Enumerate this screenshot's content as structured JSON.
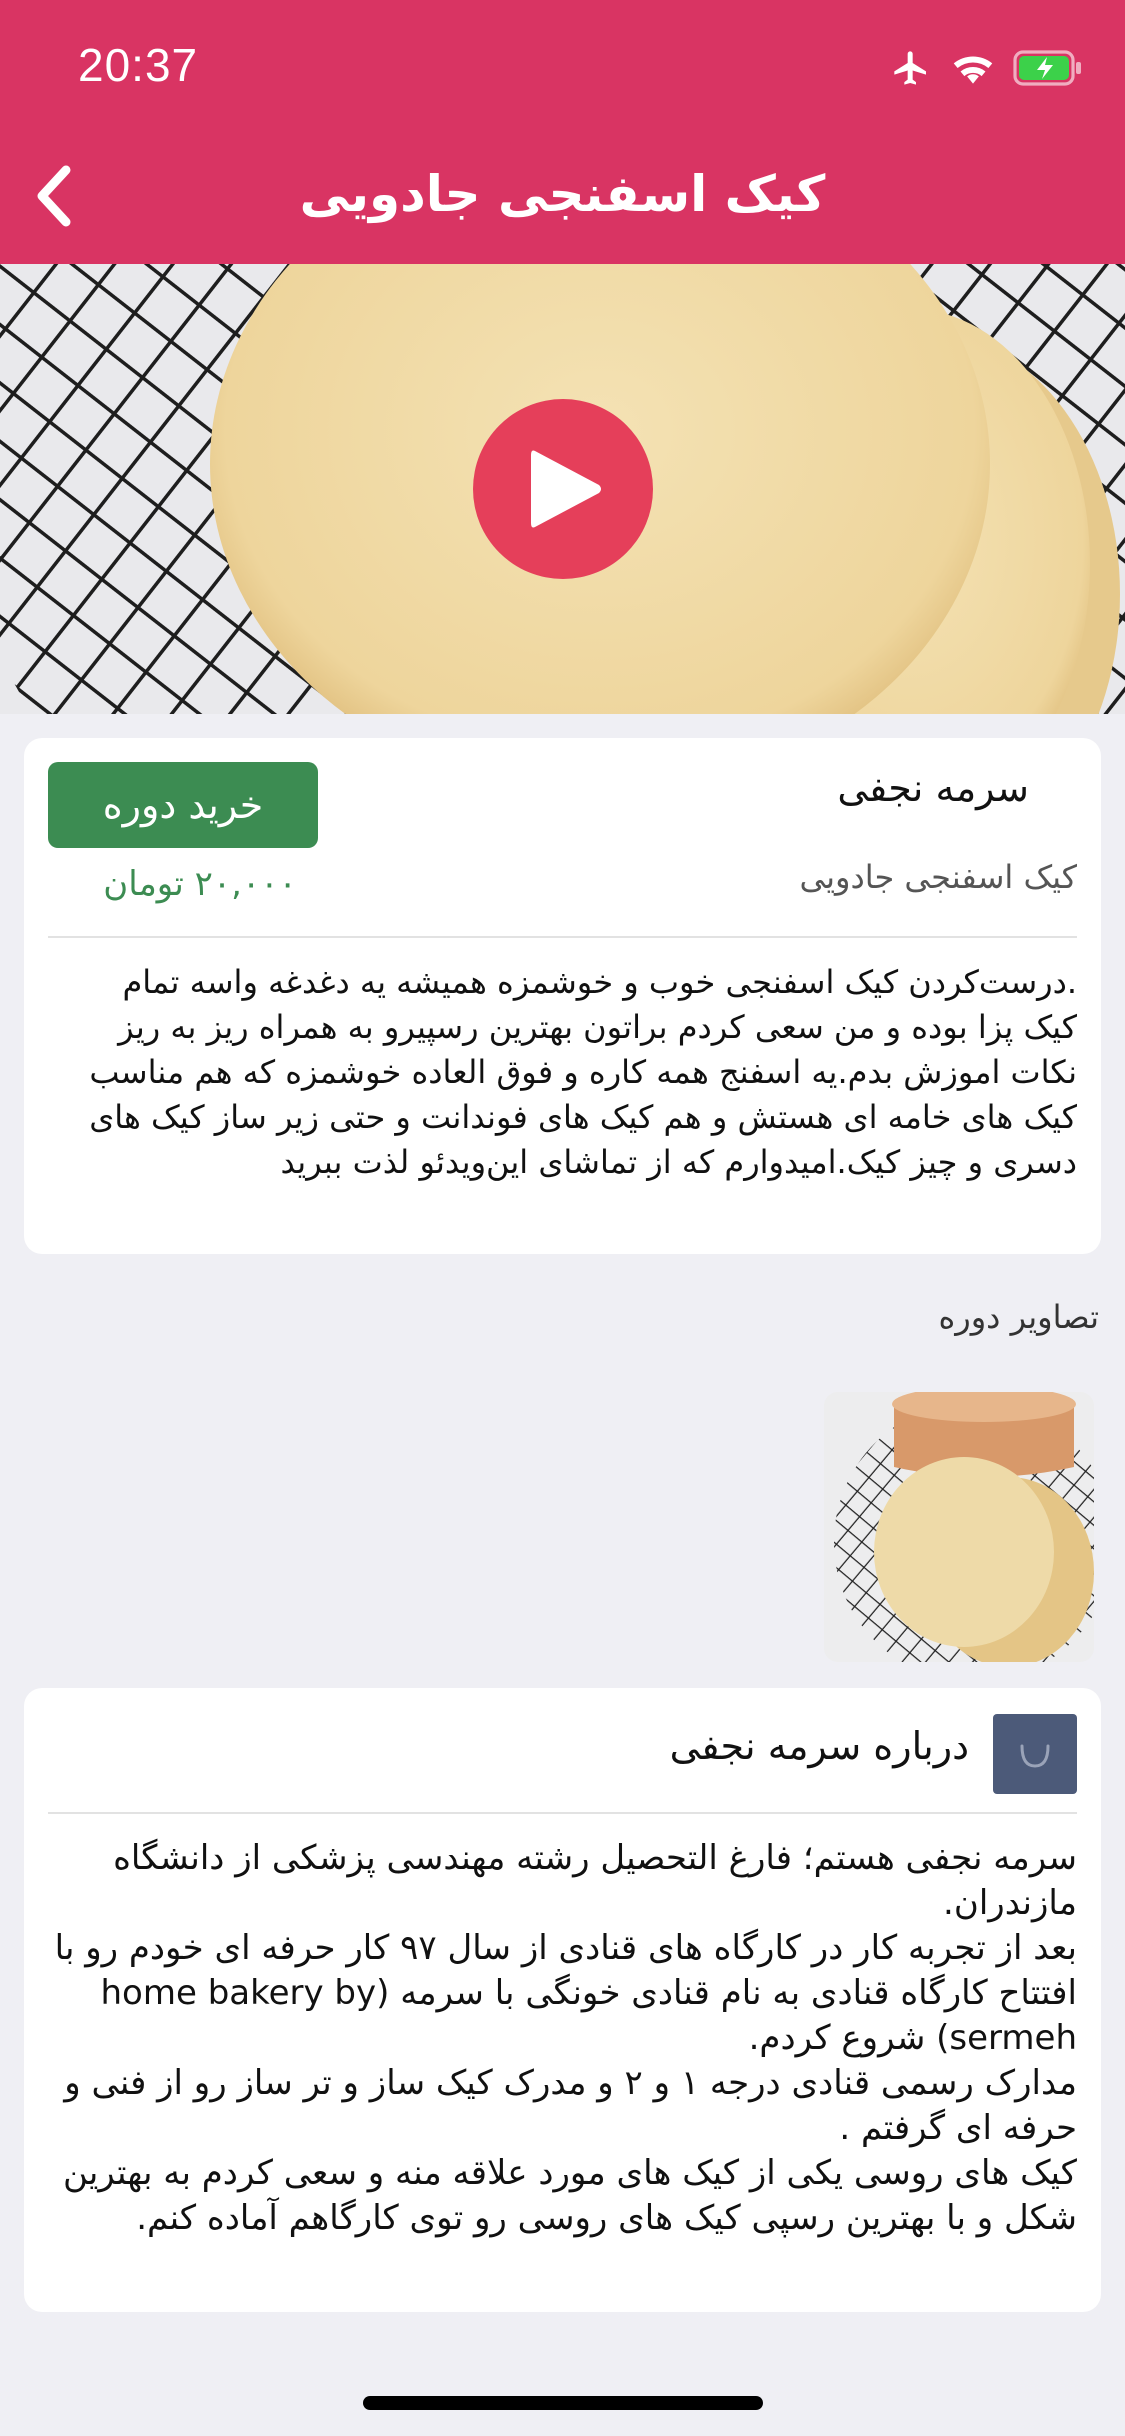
{
  "status_bar": {
    "time": "20:37",
    "icons": [
      "airplane-icon",
      "wifi-icon",
      "battery-charging-icon"
    ],
    "battery_color": "#3cd14a"
  },
  "nav": {
    "title": "کیک اسفنجی جادویی",
    "back_icon": "chevron-left-icon",
    "background": "#d93463"
  },
  "video": {
    "play_icon": "play-icon",
    "play_color": "#e53f5a"
  },
  "course": {
    "teacher": "سرمه نجفی",
    "subtitle": "کیک اسفنجی جادویی",
    "buy_label": "خرید دوره",
    "price": "۲۰,۰۰۰ تومان",
    "description": ".درست‌کردن کیک اسفنجی خوب و خوشمزه همیشه یه دغدغه واسه تمام کیک پزا بوده و من سعی کردم براتون بهترین رسپیرو به همراه ریز به ریز نکات اموزش بدم.یه اسفنج همه کاره و فوق العاده خوشمزه که هم مناسب کیک های خامه ای هستش و هم کیک های فوندانت و حتی زیر ساز کیک های دسری و چیز کیک.امیدوارم که از تماشای این‌ویدئو لذت ببرید",
    "accent": "#3c8c52"
  },
  "gallery": {
    "title": "تصاویر دوره"
  },
  "about": {
    "title": "درباره سرمه نجفی",
    "icon": "shopping-bag-icon",
    "body": "سرمه نجفی هستم؛ فارغ التحصیل رشته مهندسی پزشکی از دانشگاه مازندران.\nبعد از تجربه کار در کارگاه های قنادی از سال ۹۷ کار حرفه ای خودم رو با افتتاح کارگاه قنادی به نام قنادی خونگی با سرمه (home bakery by sermeh) شروع کردم.\nمدارک رسمی قنادی درجه ۱ و ۲ و مدرک کیک ساز و تر ساز رو از فنی و حرفه ای گرفتم .\nکیک های روسی یکی از کیک های مورد علاقه منه و سعی کردم به بهترین شکل و با بهترین رسپی کیک های روسی رو توی کارگاهم آماده کنم."
  }
}
